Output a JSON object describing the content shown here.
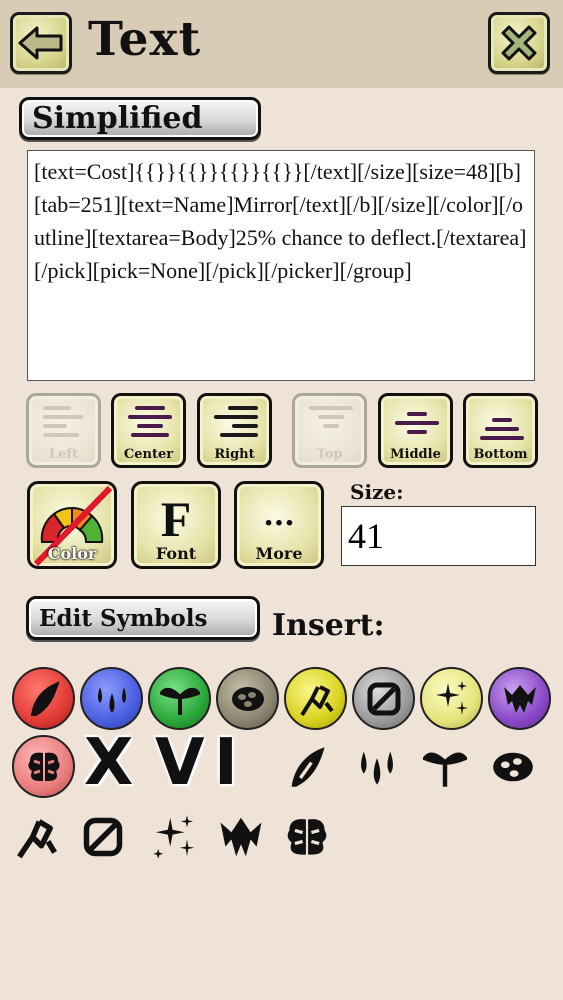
{
  "header": {
    "title": "Text"
  },
  "mode_button": {
    "label": "Simplified"
  },
  "editor": {
    "content": "[text=Cost]{{}}{{}}{{}}{{}}[/text][/size][size=48][b][tab=251][text=Name]Mirror[/text][/b][/size][/color][/outline][textarea=Body]25% chance to deflect.[/textarea][/pick][pick=None][/pick][/picker][/group]"
  },
  "alignment": {
    "left": "Left",
    "center": "Center",
    "right": "Right",
    "top": "Top",
    "middle": "Middle",
    "bottom": "Bottom"
  },
  "format": {
    "color": "Color",
    "font_icon": "F",
    "font": "Font",
    "more_icon": "...",
    "more": "More"
  },
  "size": {
    "label": "Size:",
    "value": "41"
  },
  "symbols": {
    "edit_label": "Edit Symbols",
    "insert_label": "Insert:"
  },
  "letters": [
    "X",
    "V",
    "I"
  ],
  "colors": {
    "fire": "#e23a36",
    "water": "#4a5ee0",
    "nature": "#2aa83a",
    "earth": "#8a8470",
    "air": "#d8d21e",
    "void": "#9a9a9a",
    "light": "#e6e47a",
    "dark": "#8a48c8",
    "brain": "#e87d7d"
  }
}
